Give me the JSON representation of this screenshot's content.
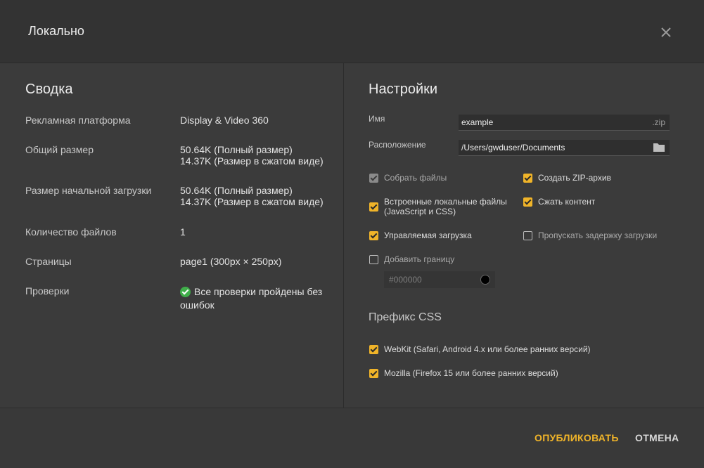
{
  "dialog": {
    "title": "Локально"
  },
  "summary": {
    "title": "Сводка",
    "rows": [
      {
        "label": "Рекламная платформа",
        "value": "Display & Video 360"
      },
      {
        "label": "Общий размер",
        "value": "50.64K (Полный размер)",
        "value2": "14.37K (Размер в сжатом виде)"
      },
      {
        "label": "Размер начальной загрузки",
        "value": "50.64K (Полный размер)",
        "value2": "14.37K (Размер в сжатом виде)"
      },
      {
        "label": "Количество файлов",
        "value": "1"
      },
      {
        "label": "Страницы",
        "value": "page1 (300px × 250px)"
      },
      {
        "label": "Проверки",
        "value": "Все проверки пройдены без ошибок"
      }
    ]
  },
  "settings": {
    "title": "Настройки",
    "name_label": "Имя",
    "name_value": "example",
    "name_suffix": ".zip",
    "location_label": "Расположение",
    "location_value": "/Users/gwduser/Documents",
    "options": {
      "collect_files": "Собрать файлы",
      "create_zip": "Создать ZIP-архив",
      "inline_local": "Встроенные локальные файлы\n(JavaScript и CSS)",
      "compress": "Сжать контент",
      "managed_load": "Управляемая загрузка",
      "skip_delay": "Пропускать задержку загрузки",
      "add_border": "Добавить границу"
    },
    "border_color": "#000000",
    "css_prefix_title": "Префикс CSS",
    "prefix_webkit": "WebKit (Safari, Android 4.x или более ранних версий)",
    "prefix_mozilla": "Mozilla (Firefox 15 или более ранних версий)"
  },
  "footer": {
    "publish": "ОПУБЛИКОВАТЬ",
    "cancel": "ОТМЕНА"
  },
  "colors": {
    "accent": "#f0b429",
    "success": "#3fae49",
    "background": "#3b3b3b"
  }
}
